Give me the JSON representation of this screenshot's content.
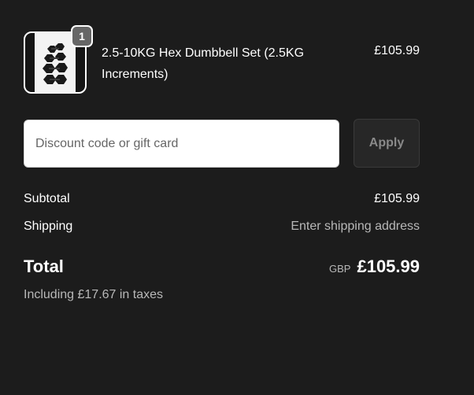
{
  "product": {
    "name": "2.5-10KG Hex Dumbbell Set (2.5KG Increments)",
    "price": "£105.99",
    "quantity": "1",
    "image_icon": "dumbbell-set-thumbnail"
  },
  "discount": {
    "placeholder": "Discount code or gift card",
    "value": "",
    "apply_label": "Apply"
  },
  "totals": {
    "subtotal_label": "Subtotal",
    "subtotal_value": "£105.99",
    "shipping_label": "Shipping",
    "shipping_value": "Enter shipping address",
    "total_label": "Total",
    "currency": "GBP",
    "total_value": "£105.99",
    "taxes_note": "Including £17.67 in taxes"
  },
  "colors": {
    "background": "#1c1c1c",
    "text": "#ffffff",
    "muted_text": "#b8b8b8",
    "badge": "#666666",
    "apply_button_bg": "#272727"
  }
}
